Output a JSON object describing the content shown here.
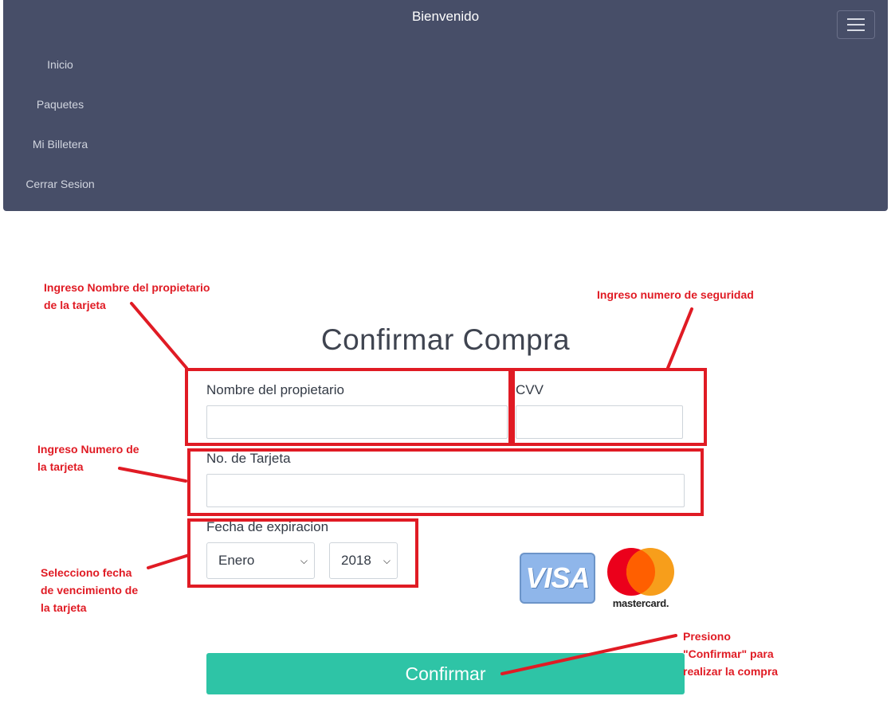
{
  "navbar": {
    "brand": "Bienvenido",
    "items": [
      {
        "label": "Inicio"
      },
      {
        "label": "Paquetes"
      },
      {
        "label": "Mi Billetera"
      },
      {
        "label": "Cerrar Sesion"
      }
    ]
  },
  "form": {
    "title": "Confirmar Compra",
    "owner_label": "Nombre del propietario",
    "owner_value": "",
    "cvv_label": "CVV",
    "cvv_value": "",
    "card_label": "No. de Tarjeta",
    "card_value": "",
    "expiry_label": "Fecha de expiracion",
    "month_selected": "Enero",
    "year_selected": "2018",
    "confirm_label": "Confirmar"
  },
  "cards": {
    "visa": "VISA",
    "mastercard": "mastercard."
  },
  "annotations": {
    "owner": "Ingreso Nombre del propietario\nde la tarjeta",
    "cvv": "Ingreso numero de seguridad",
    "card": "Ingreso Numero de\nla tarjeta",
    "expiry": "Selecciono fecha\nde vencimiento de\nla tarjeta",
    "confirm": "Presiono\n\"Confirmar\" para\nrealizar la compra"
  },
  "colors": {
    "navbar": "#474e68",
    "accent": "#2ec4a6",
    "annotation": "#e01b24"
  }
}
